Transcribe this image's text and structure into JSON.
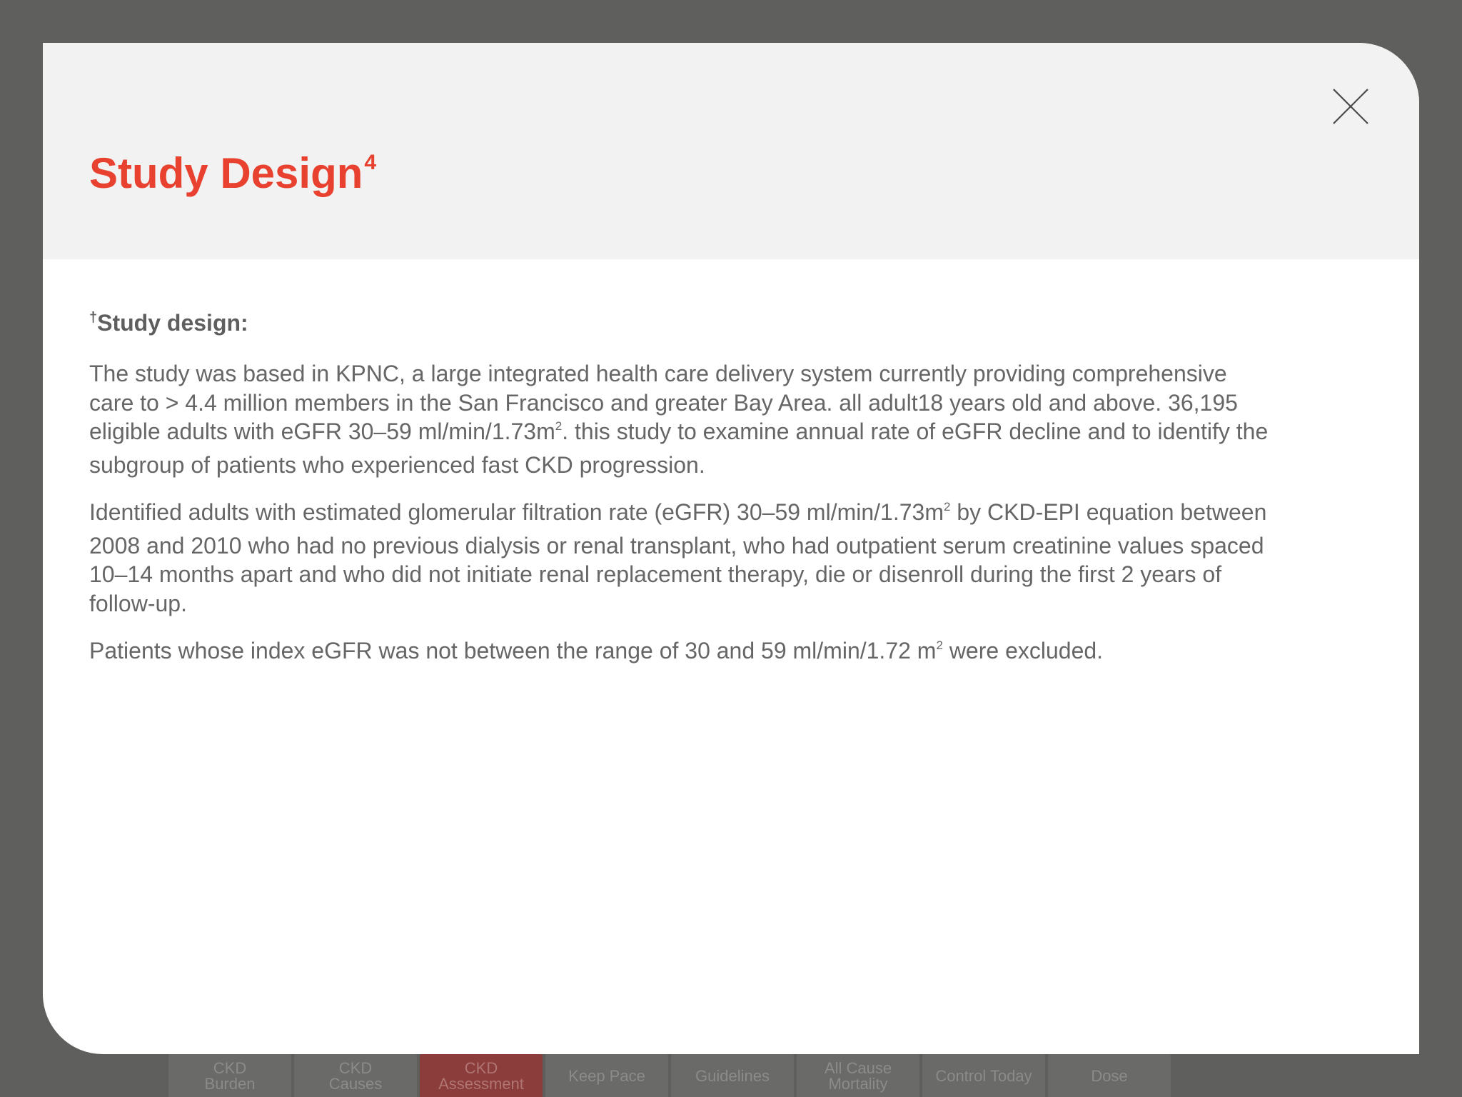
{
  "nav": {
    "tabs": [
      {
        "line1": "CKD",
        "line2": "Burden",
        "active": false
      },
      {
        "line1": "CKD",
        "line2": "Causes",
        "active": false
      },
      {
        "line1": "CKD",
        "line2": "Assessment",
        "active": true
      },
      {
        "line1": "Keep Pace",
        "line2": "",
        "active": false
      },
      {
        "line1": "Guidelines",
        "line2": "",
        "active": false
      },
      {
        "line1": "All Cause",
        "line2": "Mortality",
        "active": false
      },
      {
        "line1": "Control Today",
        "line2": "",
        "active": false
      },
      {
        "line1": "Dose",
        "line2": "",
        "active": false
      }
    ]
  },
  "modal": {
    "title": "Study Design",
    "title_sup": "4",
    "close_icon": "close-icon",
    "heading_sup": "†",
    "heading": "Study design:",
    "p1": {
      "a": "The study was based in KPNC, a large integrated health care delivery system currently providing comprehensive care to > 4.4 million members in the San Francisco and greater Bay Area. all adult18 years old and above. 36,195 eligible adults with eGFR 30–59 ml/min/1.73m",
      "sup": "2",
      "b": ". this study to examine annual rate of eGFR decline and to identify the subgroup of patients who experienced fast CKD progression."
    },
    "p2": {
      "a": "Identified adults with estimated glomerular filtration rate (eGFR) 30–59 ml/min/1.73m",
      "sup": "2",
      "b": " by CKD-EPI equation between 2008 and 2010 who had no previous dialysis or renal transplant, who had outpatient serum creatinine values spaced 10–14 months apart and who did not initiate renal replacement therapy, die or disenroll during the first 2 years of follow-up."
    },
    "p3": {
      "a": "Patients whose index eGFR was not between the range of 30 and 59 ml/min/1.72 m",
      "sup": "2",
      "b": " were excluded."
    }
  },
  "colors": {
    "backdrop": "#5f5f5e",
    "accent": "#e8412f",
    "header_bg": "#f2f2f2",
    "body_text": "#666666",
    "active_tab": "#8a3d3a"
  }
}
